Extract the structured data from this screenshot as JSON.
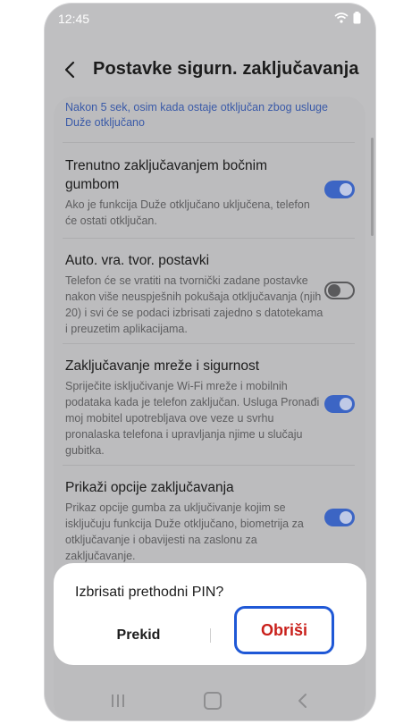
{
  "status": {
    "time": "12:45"
  },
  "header": {
    "title": "Postavke sigurn. zaključavanja"
  },
  "top_link": "Nakon 5 sek, osim kada ostaje otključan zbog usluge Duže otključano",
  "items": [
    {
      "title": "Trenutno zaključavanjem bočnim gumbom",
      "desc": "Ako je funkcija Duže otključano uključena, telefon će ostati otključan.",
      "on": true
    },
    {
      "title": "Auto. vra. tvor. postavki",
      "desc": "Telefon će se vratiti na tvornički zadane postavke nakon više neuspješnih pokušaja otključavanja (njih 20) i svi će se podaci izbrisati zajedno s datotekama i preuzetim aplikacijama.",
      "on": false
    },
    {
      "title": "Zaključavanje mreže i sigurnost",
      "desc": "Spriječite isključivanje Wi-Fi mreže i mobilnih podataka kada je telefon zaključan. Usluga Pronađi moj mobitel upotrebljava ove veze u svrhu pronalaska telefona i upravljanja njime u slučaju gubitka.",
      "on": true
    },
    {
      "title": "Prikaži opcije zaključavanja",
      "desc": "Prikaz opcije gumba za uključivanje kojim se isključuju funkcija Duže otključano, biometrija za otključavanje i obavijesti na zaslonu za zaključavanje.",
      "on": true
    }
  ],
  "dialog": {
    "message": "Izbrisati prethodni PIN?",
    "cancel_label": "Prekid",
    "delete_label": "Obriši"
  },
  "icons": {
    "back": "chevron-left-icon",
    "wifi": "wifi-icon",
    "battery": "battery-icon"
  },
  "colors": {
    "accent": "#3c65c4",
    "delete": "#c9201b",
    "highlight": "#1f58d6"
  }
}
